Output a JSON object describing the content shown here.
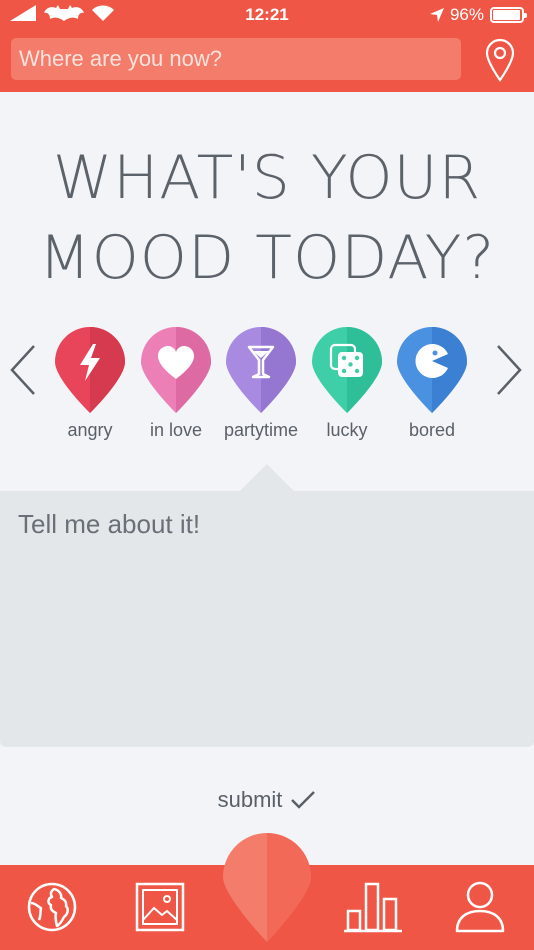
{
  "status": {
    "time": "12:21",
    "battery": "96%",
    "battery_level": 0.96
  },
  "search": {
    "placeholder": "Where are you now?"
  },
  "title": {
    "line1": "WHAT'S YOUR",
    "line2": "MOOD TODAY?"
  },
  "moods": [
    {
      "label": "angry",
      "icon": "lightning-icon",
      "color": "#e8455a",
      "dark": "#d63a4e"
    },
    {
      "label": "in love",
      "icon": "heart-icon",
      "color": "#ec7fb6",
      "dark": "#dd6aa3"
    },
    {
      "label": "partytime",
      "icon": "cocktail-icon",
      "color": "#a88ae0",
      "dark": "#9577d2"
    },
    {
      "label": "lucky",
      "icon": "dice-icon",
      "color": "#3ecfa8",
      "dark": "#2fbf98"
    },
    {
      "label": "bored",
      "icon": "pacman-icon",
      "color": "#4a91e2",
      "dark": "#3b80d3"
    }
  ],
  "note": {
    "placeholder": "Tell me about it!"
  },
  "submit": {
    "label": "submit"
  },
  "nav": {
    "items": [
      "globe-icon",
      "image-icon",
      "pin-icon",
      "bar-chart-icon",
      "user-icon"
    ]
  },
  "colors": {
    "accent": "#ef5645",
    "accent_light": "#f47c6a"
  }
}
